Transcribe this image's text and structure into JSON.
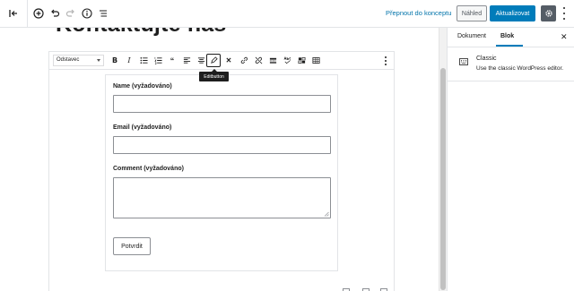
{
  "topbar": {
    "icons": [
      "back-icon",
      "add-block-icon",
      "undo-icon",
      "redo-icon",
      "info-icon",
      "list-view-icon"
    ],
    "switch_to_draft": "Přepnout do konceptu",
    "preview": "Náhled",
    "update": "Aktualizovat",
    "settings_icon": "gear-icon",
    "more_icon": "vertical-dots-icon",
    "accent": "#007cba"
  },
  "editor": {
    "page_title": "Kontaktujte nás",
    "classic_toolbar": {
      "format_select": "Odstavec",
      "tools": [
        "bold-icon",
        "italic-icon",
        "bullet-list-icon",
        "numbered-list-icon",
        "quote-icon",
        "align-left-icon",
        "align-center-icon",
        "align-right-icon",
        "edit-icon",
        "close-icon",
        "link-icon",
        "unlink-icon",
        "more-tag-icon",
        "spellcheck-icon",
        "kitchen-sink-icon",
        "table-icon"
      ],
      "tooltip": "Editbutton"
    },
    "form": {
      "name_label": "Name (vyžadováno)",
      "email_label": "Email (vyžadováno)",
      "comment_label": "Comment (vyžadováno)",
      "submit": "Potvrdit"
    }
  },
  "sidebar": {
    "tabs": [
      "Dokument",
      "Blok"
    ],
    "active_tab": "Blok",
    "block": {
      "name": "Classic",
      "description": "Use the classic WordPress editor."
    }
  }
}
